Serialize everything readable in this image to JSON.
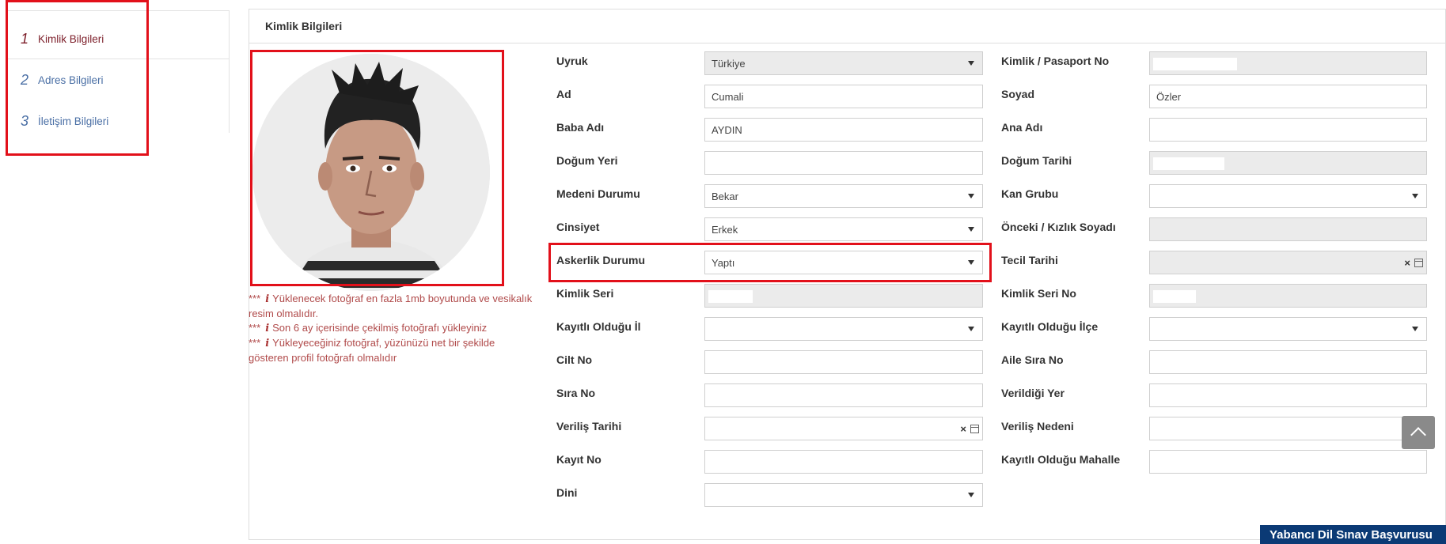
{
  "steps": [
    {
      "num": "1",
      "label": "Kimlik Bilgileri"
    },
    {
      "num": "2",
      "label": "Adres Bilgileri"
    },
    {
      "num": "3",
      "label": "İletişim Bilgileri"
    }
  ],
  "panel": {
    "title": "Kimlik Bilgileri"
  },
  "notes": {
    "marker": "***",
    "info_icon": "i",
    "n1": "Yüklenecek fotoğraf en fazla 1mb boyutunda ve vesikalık resim olmalıdır.",
    "n2": "Son 6 ay içerisinde çekilmiş fotoğrafı yükleyiniz",
    "n3": "Yükleyeceğiniz fotoğraf, yüzünüzü net bir şekilde gösteren profil fotoğrafı olmalıdır"
  },
  "form": {
    "uyruk": {
      "label": "Uyruk",
      "value": "Türkiye"
    },
    "kimlik_no": {
      "label": "Kimlik / Pasaport No",
      "value": ""
    },
    "ad": {
      "label": "Ad",
      "value": "Cumali"
    },
    "soyad": {
      "label": "Soyad",
      "value": "Özler"
    },
    "baba": {
      "label": "Baba Adı",
      "value": "AYDIN"
    },
    "ana": {
      "label": "Ana Adı",
      "value": ""
    },
    "dogum_yeri": {
      "label": "Doğum Yeri",
      "value": ""
    },
    "dogum_tarihi": {
      "label": "Doğum Tarihi",
      "value": ""
    },
    "medeni": {
      "label": "Medeni Durumu",
      "value": "Bekar"
    },
    "kan": {
      "label": "Kan Grubu",
      "value": ""
    },
    "cinsiyet": {
      "label": "Cinsiyet",
      "value": "Erkek"
    },
    "onceki": {
      "label": "Önceki / Kızlık Soyadı",
      "value": ""
    },
    "askerlik": {
      "label": "Askerlik Durumu",
      "value": "Yaptı"
    },
    "tecil": {
      "label": "Tecil Tarihi",
      "value": ""
    },
    "kimlik_seri": {
      "label": "Kimlik Seri",
      "value": ""
    },
    "kimlik_seri_no": {
      "label": "Kimlik Seri No",
      "value": ""
    },
    "kayitli_il": {
      "label": "Kayıtlı Olduğu İl",
      "value": ""
    },
    "kayitli_ilce": {
      "label": "Kayıtlı Olduğu İlçe",
      "value": ""
    },
    "cilt": {
      "label": "Cilt No",
      "value": ""
    },
    "aile_sira": {
      "label": "Aile Sıra No",
      "value": ""
    },
    "sira": {
      "label": "Sıra No",
      "value": ""
    },
    "verildigi_yer": {
      "label": "Verildiği Yer",
      "value": ""
    },
    "verilis_tarihi": {
      "label": "Veriliş Tarihi",
      "value": ""
    },
    "verilis_nedeni": {
      "label": "Veriliş Nedeni",
      "value": ""
    },
    "kayit_no": {
      "label": "Kayıt No",
      "value": ""
    },
    "mahalle": {
      "label": "Kayıtlı Olduğu Mahalle",
      "value": ""
    },
    "dini": {
      "label": "Dini",
      "value": ""
    }
  },
  "banner": {
    "text": "Yabancı Dil Sınav Başvurusu"
  }
}
